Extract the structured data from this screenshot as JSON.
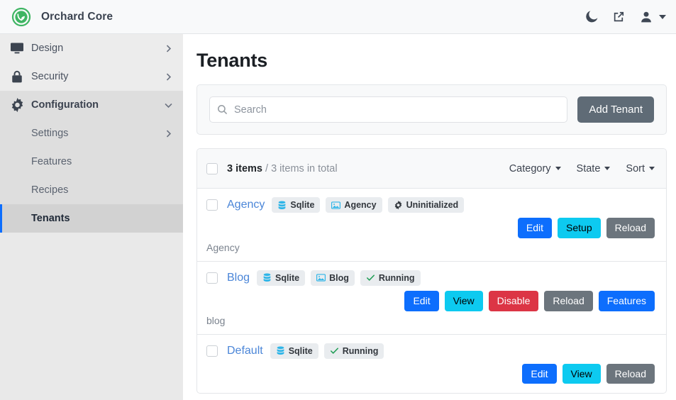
{
  "topbar": {
    "brand": "Orchard Core",
    "logo_color": "#3fb563",
    "icons": [
      {
        "name": "moon-icon",
        "title": "dark-mode-toggle"
      },
      {
        "name": "external-link-icon",
        "title": "visit-site"
      },
      {
        "name": "user-icon",
        "title": "user-menu"
      }
    ]
  },
  "sidebar": {
    "items": [
      {
        "label": "Design",
        "icon": "monitor-icon",
        "chevron": "right",
        "level": 0
      },
      {
        "label": "Security",
        "icon": "lock-icon",
        "chevron": "right",
        "level": 0
      },
      {
        "label": "Configuration",
        "icon": "gear-icon",
        "chevron": "down",
        "level": 0,
        "expanded": true
      },
      {
        "label": "Settings",
        "icon": "",
        "chevron": "right",
        "level": 1
      },
      {
        "label": "Features",
        "icon": "",
        "chevron": "",
        "level": 1
      },
      {
        "label": "Recipes",
        "icon": "",
        "chevron": "",
        "level": 1
      },
      {
        "label": "Tenants",
        "icon": "",
        "chevron": "",
        "level": 1,
        "active": true
      }
    ],
    "active_accent": "#0d6efd"
  },
  "main": {
    "page_title": "Tenants",
    "search": {
      "placeholder": "Search",
      "value": "",
      "icon": "search-icon"
    },
    "add_tenant_label": "Add Tenant",
    "list_header": {
      "count_bold": "3 items",
      "count_rest": " / 3 items in total",
      "dropdowns": [
        {
          "label": "Category"
        },
        {
          "label": "State"
        },
        {
          "label": "Sort"
        }
      ]
    },
    "tenants": [
      {
        "name": "Agency",
        "description": "Agency",
        "badges": [
          {
            "label": "Sqlite",
            "icon": "database-icon"
          },
          {
            "label": "Agency",
            "icon": "image-icon"
          },
          {
            "label": "Uninitialized",
            "icon": "gear-icon"
          }
        ],
        "buttons": [
          {
            "label": "Edit",
            "style": "btn-primary"
          },
          {
            "label": "Setup",
            "style": "btn-info"
          },
          {
            "label": "Reload",
            "style": "btn-secondary"
          }
        ]
      },
      {
        "name": "Blog",
        "description": "blog",
        "badges": [
          {
            "label": "Sqlite",
            "icon": "database-icon"
          },
          {
            "label": "Blog",
            "icon": "image-icon"
          },
          {
            "label": "Running",
            "icon": "check-icon"
          }
        ],
        "buttons": [
          {
            "label": "Edit",
            "style": "btn-primary"
          },
          {
            "label": "View",
            "style": "btn-info"
          },
          {
            "label": "Disable",
            "style": "btn-danger"
          },
          {
            "label": "Reload",
            "style": "btn-secondary"
          },
          {
            "label": "Features",
            "style": "btn-primary"
          }
        ]
      },
      {
        "name": "Default",
        "description": "",
        "badges": [
          {
            "label": "Sqlite",
            "icon": "database-icon"
          },
          {
            "label": "Running",
            "icon": "check-icon"
          }
        ],
        "buttons": [
          {
            "label": "Edit",
            "style": "btn-primary"
          },
          {
            "label": "View",
            "style": "btn-info"
          },
          {
            "label": "Reload",
            "style": "btn-secondary"
          }
        ]
      }
    ]
  },
  "colors": {
    "primary": "#0d6efd",
    "info": "#0dcaf0",
    "danger": "#dc3545",
    "secondary": "#6c757d",
    "link": "#4b86d8",
    "badge_bg": "#e9ecef"
  }
}
